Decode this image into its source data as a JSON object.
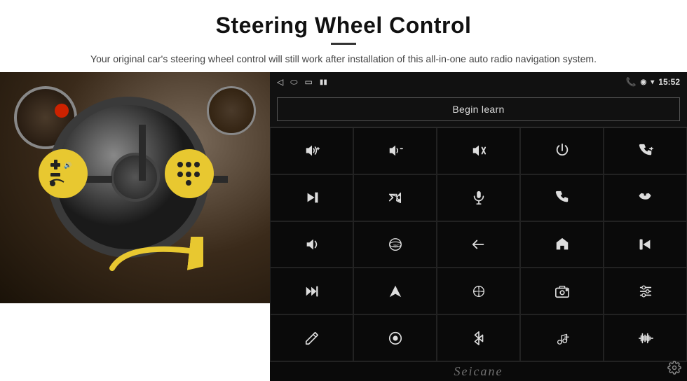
{
  "header": {
    "title": "Steering Wheel Control",
    "subtitle": "Your original car's steering wheel control will still work after installation of this all-in-one auto radio navigation system."
  },
  "statusBar": {
    "time": "15:52",
    "navIcons": [
      "back-arrow",
      "home-circle",
      "square-icon",
      "signal-icon"
    ],
    "rightIcons": [
      "phone-icon",
      "location-icon",
      "wifi-icon"
    ]
  },
  "beginLearn": {
    "label": "Begin learn"
  },
  "controls": [
    {
      "id": "vol-up",
      "title": "Volume Up"
    },
    {
      "id": "vol-down",
      "title": "Volume Down"
    },
    {
      "id": "mute",
      "title": "Mute"
    },
    {
      "id": "power",
      "title": "Power"
    },
    {
      "id": "phone-prev",
      "title": "Phone/Prev"
    },
    {
      "id": "next-track",
      "title": "Next Track"
    },
    {
      "id": "shuffle",
      "title": "Shuffle"
    },
    {
      "id": "mic",
      "title": "Microphone"
    },
    {
      "id": "phone",
      "title": "Phone"
    },
    {
      "id": "hang-up",
      "title": "Hang Up"
    },
    {
      "id": "horn",
      "title": "Horn"
    },
    {
      "id": "360",
      "title": "360 View"
    },
    {
      "id": "back",
      "title": "Back"
    },
    {
      "id": "home",
      "title": "Home"
    },
    {
      "id": "prev-track",
      "title": "Previous Track"
    },
    {
      "id": "fast-forward",
      "title": "Fast Forward"
    },
    {
      "id": "navigation",
      "title": "Navigation"
    },
    {
      "id": "eq",
      "title": "Equalizer"
    },
    {
      "id": "camera",
      "title": "Camera"
    },
    {
      "id": "settings-eq",
      "title": "Settings EQ"
    },
    {
      "id": "pen",
      "title": "Pen"
    },
    {
      "id": "circle-dot",
      "title": "Circle"
    },
    {
      "id": "bluetooth",
      "title": "Bluetooth"
    },
    {
      "id": "music-settings",
      "title": "Music Settings"
    },
    {
      "id": "sound-wave",
      "title": "Sound Wave"
    }
  ],
  "seicane": {
    "brand": "Seicane"
  }
}
